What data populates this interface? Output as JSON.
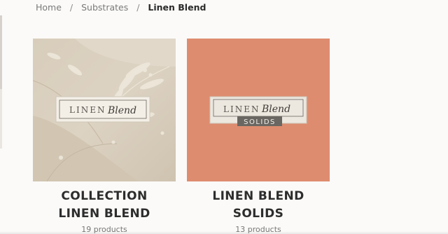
{
  "breadcrumb": {
    "items": [
      "Home",
      "Substrates",
      "Linen Blend"
    ],
    "separator": "/"
  },
  "collections": [
    {
      "title": "COLLECTION LINEN BLEND",
      "count": "19 products",
      "label_top": "LINEN",
      "label_script": "Blend",
      "image_color": "#d9cfbf"
    },
    {
      "title": "LINEN BLEND SOLIDS",
      "count": "13 products",
      "label_top": "LINEN",
      "label_script": "Blend",
      "label_sub": "SOLIDS",
      "image_color": "#dd8a6d"
    }
  ]
}
